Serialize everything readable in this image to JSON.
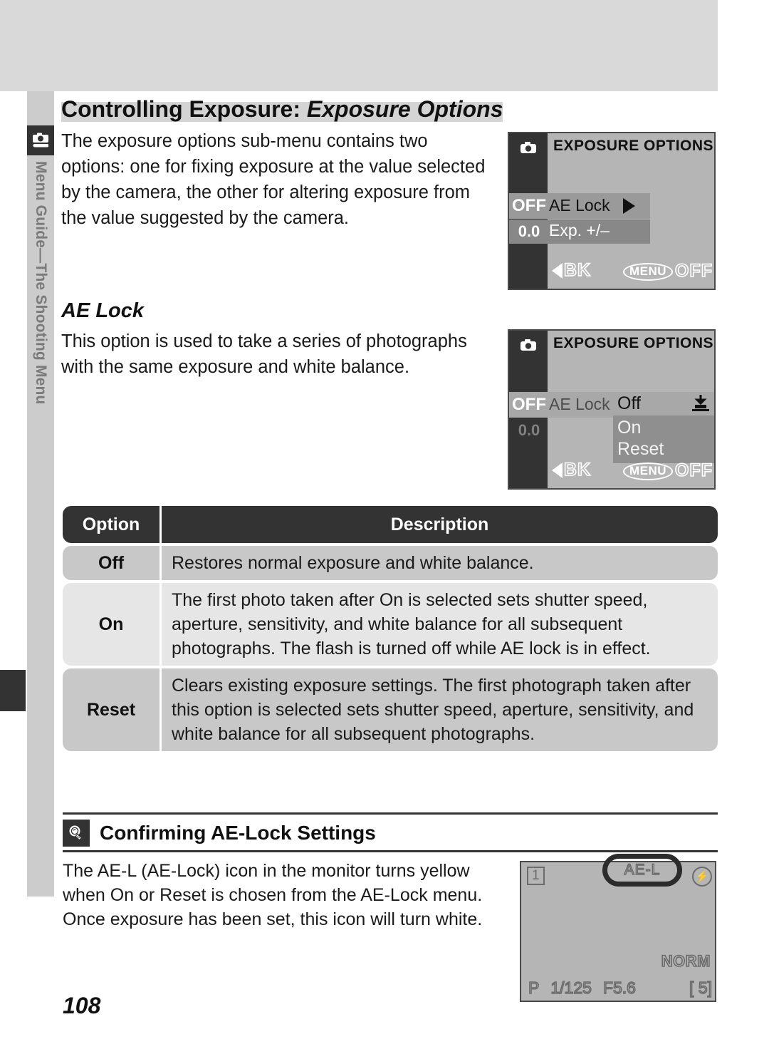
{
  "page": {
    "number": "108",
    "title_plain": "Controlling Exposure: ",
    "title_italic": "Exposure Options"
  },
  "sidebar": {
    "label": "Menu Guide—The Shooting Menu",
    "icon": "camera-icon"
  },
  "intro": {
    "paragraph": "The exposure options sub-menu contains two options: one for fixing exposure at the value selected by the camera, the other for altering exposure from the value suggested by the camera."
  },
  "ae_lock_section": {
    "heading": "AE Lock",
    "paragraph": "This option is used to take a series of photographs with the same exposure and white balance."
  },
  "screen_one": {
    "title": "EXPOSURE OPTIONS",
    "rows": [
      {
        "badge": "OFF",
        "label": "AE Lock",
        "arrow": "▶"
      },
      {
        "badge": "0.0",
        "label": "Exp. +/–"
      }
    ],
    "bottom_left": "BK",
    "bottom_menu": "MENU",
    "bottom_right": "OFF"
  },
  "screen_two": {
    "title": "EXPOSURE OPTIONS",
    "row_badge": "OFF",
    "row_label": "AE Lock",
    "row_badge_2": "0.0",
    "submenu_options": [
      "Off",
      "On",
      "Reset"
    ],
    "submenu_selected": "Off",
    "bottom_left": "BK",
    "bottom_menu": "MENU",
    "bottom_right": "OFF"
  },
  "table": {
    "headers": {
      "option": "Option",
      "description": "Description"
    },
    "rows": [
      {
        "option": "Off",
        "description": "Restores normal exposure and white balance."
      },
      {
        "option": "On",
        "description": "The first photo taken after On is selected sets shutter speed, aperture, sensitivity, and white balance for all subsequent photographs.  The flash is turned off while AE lock is in effect."
      },
      {
        "option": "Reset",
        "description": "Clears existing exposure settings.  The first photograph taken after this option is selected sets shutter speed, aperture, sensitivity, and white balance for all subsequent photographs."
      }
    ]
  },
  "tip": {
    "icon": "lightbulb-icon",
    "title": "Confirming AE-Lock Settings",
    "paragraph": "The AE-L (AE-Lock) icon in the monitor turns yellow when On or Reset is chosen from the AE-Lock menu.  Once exposure has been set, this icon will turn white."
  },
  "monitor": {
    "frame_number": "1",
    "ael_badge": "AE-L",
    "flash_icon": "flash-off-icon",
    "quality": "NORM",
    "mode": "P",
    "shutter": "1/125",
    "aperture": "F5.6",
    "frames_remaining": "5"
  },
  "colors": {
    "band_gray": "#d9d9d9",
    "sidebar_gray": "#cccccc",
    "dark": "#333333",
    "screen_bg": "#b5b5b5",
    "row_dark": "#c8c8c8",
    "row_light": "#e6e6e6"
  }
}
